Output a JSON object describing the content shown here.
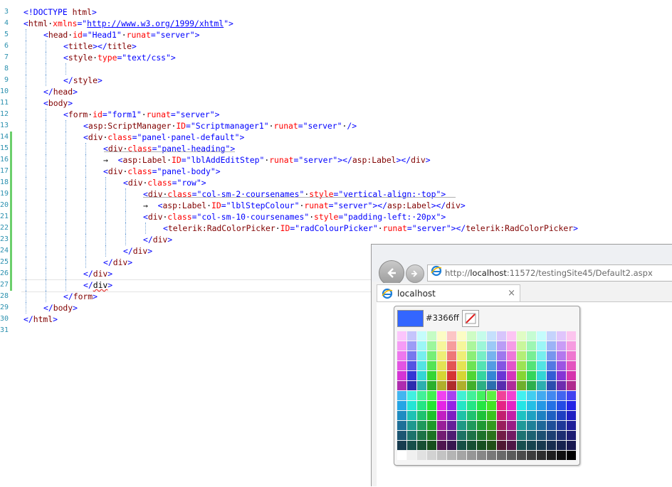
{
  "editor": {
    "lines": [
      {
        "num": "3",
        "changed": false,
        "indent": 0,
        "tokens": [
          [
            "punct",
            "<!DOCTYPE"
          ],
          [
            "text",
            " "
          ],
          [
            "tag",
            "html"
          ],
          [
            "punct",
            ">"
          ]
        ]
      },
      {
        "num": "4",
        "changed": false,
        "indent": 0,
        "tokens": [
          [
            "punct",
            "<"
          ],
          [
            "tag",
            "html"
          ],
          [
            "text",
            "·"
          ],
          [
            "attr",
            "xmlns"
          ],
          [
            "punct",
            "=\""
          ],
          [
            "link",
            "http://www.w3.org/1999/xhtml"
          ],
          [
            "punct",
            "\">"
          ]
        ]
      },
      {
        "num": "5",
        "changed": false,
        "indent": 1,
        "tokens": [
          [
            "punct",
            "<"
          ],
          [
            "tag",
            "head"
          ],
          [
            "text",
            "·"
          ],
          [
            "attr",
            "id"
          ],
          [
            "punct",
            "=\""
          ],
          [
            "val",
            "Head1"
          ],
          [
            "punct",
            "\""
          ],
          [
            "text",
            "·"
          ],
          [
            "attr",
            "runat"
          ],
          [
            "punct",
            "=\""
          ],
          [
            "val",
            "server"
          ],
          [
            "punct",
            "\">"
          ]
        ]
      },
      {
        "num": "6",
        "changed": false,
        "indent": 2,
        "tokens": [
          [
            "punct",
            "<"
          ],
          [
            "tag",
            "title"
          ],
          [
            "punct",
            "></"
          ],
          [
            "tag",
            "title"
          ],
          [
            "punct",
            ">"
          ]
        ]
      },
      {
        "num": "7",
        "changed": false,
        "indent": 2,
        "tokens": [
          [
            "punct",
            "<"
          ],
          [
            "tag",
            "style"
          ],
          [
            "text",
            "·"
          ],
          [
            "attr",
            "type"
          ],
          [
            "punct",
            "=\""
          ],
          [
            "val",
            "text/css"
          ],
          [
            "punct",
            "\">"
          ]
        ]
      },
      {
        "num": "8",
        "changed": false,
        "indent": 3,
        "tokens": [
          [
            "text",
            ""
          ]
        ]
      },
      {
        "num": "9",
        "changed": false,
        "indent": 2,
        "tokens": [
          [
            "punct",
            "</"
          ],
          [
            "tag",
            "style"
          ],
          [
            "punct",
            ">"
          ]
        ]
      },
      {
        "num": "10",
        "changed": false,
        "indent": 1,
        "tokens": [
          [
            "punct",
            "</"
          ],
          [
            "tag",
            "head"
          ],
          [
            "punct",
            ">"
          ]
        ]
      },
      {
        "num": "11",
        "changed": false,
        "indent": 1,
        "tokens": [
          [
            "punct",
            "<"
          ],
          [
            "tag",
            "body"
          ],
          [
            "punct",
            ">"
          ]
        ]
      },
      {
        "num": "12",
        "changed": false,
        "indent": 2,
        "tokens": [
          [
            "punct",
            "<"
          ],
          [
            "tag",
            "form"
          ],
          [
            "text",
            "·"
          ],
          [
            "attr",
            "id"
          ],
          [
            "punct",
            "=\""
          ],
          [
            "val",
            "form1"
          ],
          [
            "punct",
            "\""
          ],
          [
            "text",
            "·"
          ],
          [
            "attr",
            "runat"
          ],
          [
            "punct",
            "=\""
          ],
          [
            "val",
            "server"
          ],
          [
            "punct",
            "\">"
          ]
        ]
      },
      {
        "num": "13",
        "changed": false,
        "indent": 3,
        "tokens": [
          [
            "punct",
            "<"
          ],
          [
            "tag",
            "asp:ScriptManager"
          ],
          [
            "text",
            "·"
          ],
          [
            "attr",
            "ID"
          ],
          [
            "punct",
            "=\""
          ],
          [
            "val",
            "Scriptmanager1"
          ],
          [
            "punct",
            "\""
          ],
          [
            "text",
            "·"
          ],
          [
            "attr",
            "runat"
          ],
          [
            "punct",
            "=\""
          ],
          [
            "val",
            "server"
          ],
          [
            "punct",
            "\""
          ],
          [
            "text",
            "·"
          ],
          [
            "punct",
            "/>"
          ]
        ]
      },
      {
        "num": "14",
        "changed": true,
        "indent": 3,
        "tokens": [
          [
            "punct",
            "<"
          ],
          [
            "tag",
            "div"
          ],
          [
            "text",
            "·"
          ],
          [
            "attr",
            "class"
          ],
          [
            "punct",
            "=\""
          ],
          [
            "val",
            "panel·panel-default"
          ],
          [
            "punct",
            "\">"
          ]
        ]
      },
      {
        "num": "15",
        "changed": true,
        "indent": 4,
        "tokens": [
          [
            "punct",
            "<"
          ],
          [
            "tag",
            "div"
          ],
          [
            "text",
            "·"
          ],
          [
            "attr",
            "class"
          ],
          [
            "punct",
            "=\""
          ],
          [
            "val",
            "panel-heading"
          ],
          [
            "punct",
            "\">"
          ]
        ]
      },
      {
        "num": "16",
        "changed": true,
        "indent": 4,
        "tokens": [
          [
            "text",
            "→  "
          ],
          [
            "punct",
            "<"
          ],
          [
            "tag",
            "asp:Label"
          ],
          [
            "text",
            "·"
          ],
          [
            "attr",
            "ID"
          ],
          [
            "punct",
            "=\""
          ],
          [
            "val",
            "lblAddEditStep"
          ],
          [
            "punct",
            "\""
          ],
          [
            "text",
            "·"
          ],
          [
            "attr",
            "runat"
          ],
          [
            "punct",
            "=\""
          ],
          [
            "val",
            "server"
          ],
          [
            "punct",
            "\"></"
          ],
          [
            "tag",
            "asp:Label"
          ],
          [
            "punct",
            "></"
          ],
          [
            "tag",
            "div"
          ],
          [
            "punct",
            ">"
          ]
        ]
      },
      {
        "num": "17",
        "changed": true,
        "indent": 4,
        "tokens": [
          [
            "punct",
            "<"
          ],
          [
            "tag",
            "div"
          ],
          [
            "text",
            "·"
          ],
          [
            "attr",
            "class"
          ],
          [
            "punct",
            "=\""
          ],
          [
            "val",
            "panel-body"
          ],
          [
            "punct",
            "\">"
          ]
        ]
      },
      {
        "num": "18",
        "changed": true,
        "indent": 5,
        "tokens": [
          [
            "punct",
            "<"
          ],
          [
            "tag",
            "div"
          ],
          [
            "text",
            "·"
          ],
          [
            "attr",
            "class"
          ],
          [
            "punct",
            "=\""
          ],
          [
            "val",
            "row"
          ],
          [
            "punct",
            "\">"
          ]
        ]
      },
      {
        "num": "19",
        "changed": true,
        "indent": 6,
        "tokens": [
          [
            "punct",
            "<"
          ],
          [
            "tag",
            "div"
          ],
          [
            "text",
            "·"
          ],
          [
            "attr",
            "class"
          ],
          [
            "punct",
            "=\""
          ],
          [
            "val",
            "col-sm-2·coursenames"
          ],
          [
            "punct",
            "\""
          ],
          [
            "text",
            "·"
          ],
          [
            "attr",
            "style"
          ],
          [
            "punct",
            "=\""
          ],
          [
            "val",
            "vertical-align:·top"
          ],
          [
            "punct",
            "\">"
          ]
        ]
      },
      {
        "num": "20",
        "changed": true,
        "indent": 6,
        "tokens": [
          [
            "text",
            "→  "
          ],
          [
            "punct",
            "<"
          ],
          [
            "tag",
            "asp:Label"
          ],
          [
            "text",
            "·"
          ],
          [
            "attr",
            "ID"
          ],
          [
            "punct",
            "=\""
          ],
          [
            "val",
            "lblStepColour"
          ],
          [
            "punct",
            "\""
          ],
          [
            "text",
            "·"
          ],
          [
            "attr",
            "runat"
          ],
          [
            "punct",
            "=\""
          ],
          [
            "val",
            "server"
          ],
          [
            "punct",
            "\"></"
          ],
          [
            "tag",
            "asp:Label"
          ],
          [
            "punct",
            "></"
          ],
          [
            "tag",
            "div"
          ],
          [
            "punct",
            ">"
          ]
        ]
      },
      {
        "num": "21",
        "changed": true,
        "indent": 6,
        "tokens": [
          [
            "punct",
            "<"
          ],
          [
            "tag",
            "div"
          ],
          [
            "text",
            "·"
          ],
          [
            "attr",
            "class"
          ],
          [
            "punct",
            "=\""
          ],
          [
            "val",
            "col-sm-10·coursenames"
          ],
          [
            "punct",
            "\""
          ],
          [
            "text",
            "·"
          ],
          [
            "attr",
            "style"
          ],
          [
            "punct",
            "=\""
          ],
          [
            "val",
            "padding-left:·20px"
          ],
          [
            "punct",
            "\">"
          ]
        ]
      },
      {
        "num": "22",
        "changed": true,
        "indent": 7,
        "tokens": [
          [
            "punct",
            "<"
          ],
          [
            "tag",
            "telerik:RadColorPicker"
          ],
          [
            "text",
            "·"
          ],
          [
            "attr",
            "ID"
          ],
          [
            "punct",
            "=\""
          ],
          [
            "val",
            "radColourPicker"
          ],
          [
            "punct",
            "\""
          ],
          [
            "text",
            "·"
          ],
          [
            "attr",
            "runat"
          ],
          [
            "punct",
            "=\""
          ],
          [
            "val",
            "server"
          ],
          [
            "punct",
            "\"></"
          ],
          [
            "tag",
            "telerik:RadColorPicker"
          ],
          [
            "punct",
            ">"
          ]
        ]
      },
      {
        "num": "23",
        "changed": true,
        "indent": 6,
        "tokens": [
          [
            "punct",
            "</"
          ],
          [
            "tag",
            "div"
          ],
          [
            "punct",
            ">"
          ]
        ]
      },
      {
        "num": "24",
        "changed": true,
        "indent": 5,
        "tokens": [
          [
            "punct",
            "</"
          ],
          [
            "tag",
            "div"
          ],
          [
            "punct",
            ">"
          ]
        ]
      },
      {
        "num": "25",
        "changed": true,
        "indent": 4,
        "tokens": [
          [
            "punct",
            "</"
          ],
          [
            "tag",
            "div"
          ],
          [
            "punct",
            ">"
          ]
        ]
      },
      {
        "num": "26",
        "changed": true,
        "indent": 3,
        "tokens": [
          [
            "punct",
            "</"
          ],
          [
            "tag",
            "div"
          ],
          [
            "punct",
            ">"
          ]
        ]
      },
      {
        "num": "27",
        "changed": true,
        "indent": 3,
        "tokens": [
          [
            "punct",
            "</"
          ],
          [
            "sq",
            "div"
          ],
          [
            "punct",
            ">"
          ]
        ]
      },
      {
        "num": "28",
        "changed": false,
        "indent": 2,
        "tokens": [
          [
            "punct",
            "</"
          ],
          [
            "tag",
            "form"
          ],
          [
            "punct",
            ">"
          ]
        ]
      },
      {
        "num": "29",
        "changed": false,
        "indent": 1,
        "tokens": [
          [
            "punct",
            "</"
          ],
          [
            "tag",
            "body"
          ],
          [
            "punct",
            ">"
          ]
        ]
      },
      {
        "num": "30",
        "changed": false,
        "indent": 0,
        "tokens": [
          [
            "punct",
            "</"
          ],
          [
            "tag",
            "html"
          ],
          [
            "punct",
            ">"
          ]
        ]
      },
      {
        "num": "31",
        "changed": false,
        "indent": 0,
        "tokens": [
          [
            "text",
            ""
          ]
        ]
      }
    ]
  },
  "browser": {
    "url_prefix": "http://",
    "url_host": "localhost",
    "url_rest": ":11572/testingSite45/Default2.aspx",
    "tab_title": "localhost",
    "tab_close": "×"
  },
  "color_picker": {
    "selected_color": "#3366ff",
    "hex_label": "#3366ff"
  }
}
